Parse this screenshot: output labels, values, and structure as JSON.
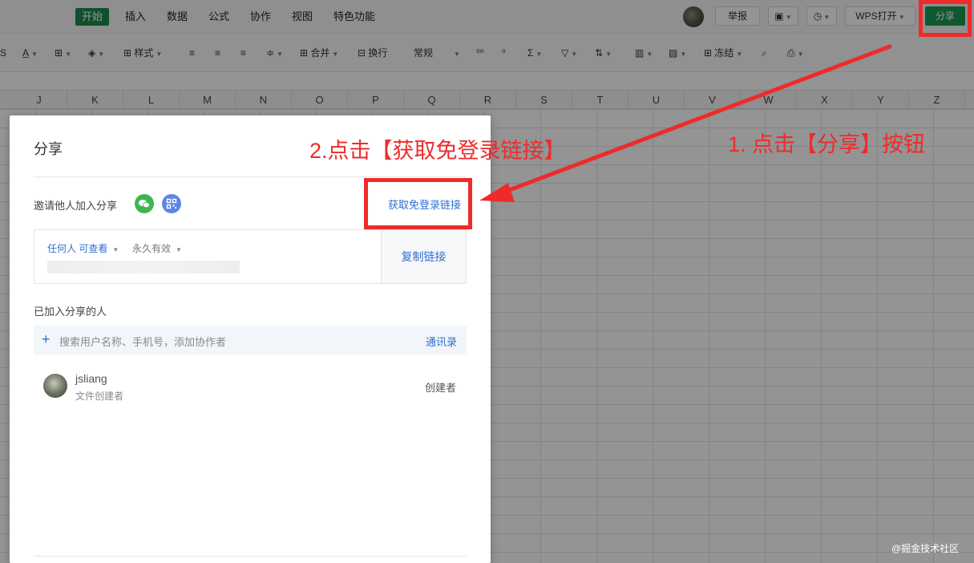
{
  "menubar": {
    "items": [
      "开始",
      "插入",
      "数据",
      "公式",
      "协作",
      "视图",
      "特色功能"
    ],
    "active_index": 0,
    "report_label": "举报",
    "open_label": "WPS打开",
    "share_label": "分享"
  },
  "toolbar": {
    "style_label": "样式",
    "merge_label": "合并",
    "wrap_label": "换行",
    "format_value": "常规",
    "freeze_label": "冻结"
  },
  "columns": [
    "J",
    "K",
    "L",
    "M",
    "N",
    "O",
    "P",
    "Q",
    "R",
    "S",
    "T",
    "U",
    "V",
    "W",
    "X",
    "Y",
    "Z"
  ],
  "dialog": {
    "title": "分享",
    "invite_label": "邀请他人加入分享",
    "get_link_label": "获取免登录链接",
    "permission": "任何人 可查看",
    "expiry": "永久有效",
    "copy_link_label": "复制链接",
    "joined_label": "已加入分享的人",
    "search_placeholder": "搜索用户名称、手机号，添加协作者",
    "contacts_label": "通讯录",
    "member": {
      "name": "jsliang",
      "subtitle": "文件创建者",
      "role": "创建者"
    }
  },
  "annotations": {
    "step1": "1. 点击【分享】按钮",
    "step2": "2.点击【获取免登录链接】",
    "color": "#ee2b2b"
  },
  "watermark": "@掘金技术社区"
}
